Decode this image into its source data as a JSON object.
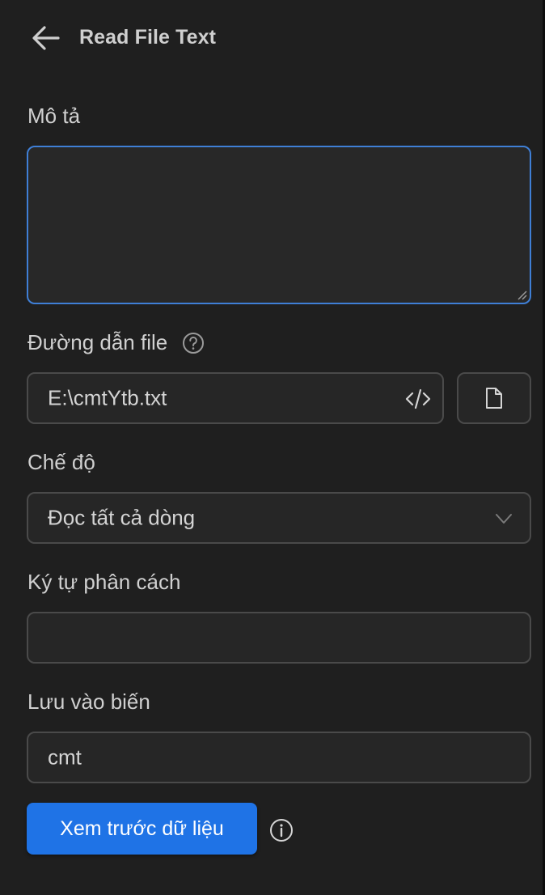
{
  "header": {
    "title": "Read File Text",
    "back_icon": "arrow-left-icon"
  },
  "description": {
    "label": "Mô tả",
    "value": ""
  },
  "file_path": {
    "label": "Đường dẫn file",
    "value": "E:\\cmtYtb.txt",
    "help_icon": "question-circle-icon",
    "code_icon": "code-icon",
    "browse_icon": "file-icon"
  },
  "mode": {
    "label": "Chế độ",
    "selected": "Đọc tất cả dòng"
  },
  "separator": {
    "label": "Ký tự phân cách",
    "value": ""
  },
  "save_var": {
    "label": "Lưu vào biến",
    "value": "cmt"
  },
  "preview": {
    "button_label": "Xem trước dữ liệu",
    "info_icon": "info-icon"
  },
  "colors": {
    "background": "#1f1f1f",
    "field": "#262626",
    "accent": "#1f73e6",
    "focus_border": "#3f7fd6"
  }
}
